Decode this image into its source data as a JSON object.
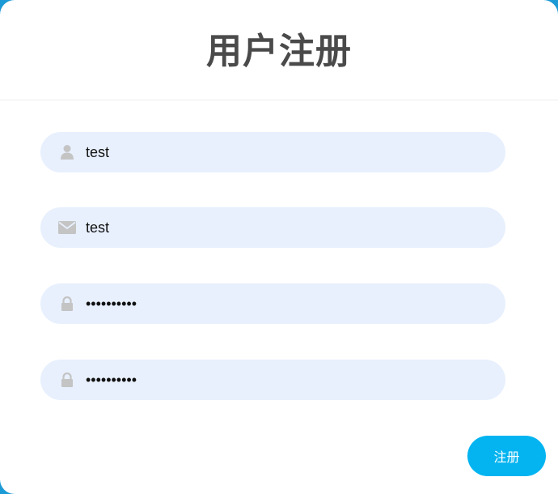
{
  "header": {
    "title": "用户注册"
  },
  "form": {
    "fields": [
      {
        "icon": "user-icon",
        "type": "text",
        "value": "test"
      },
      {
        "icon": "envelope-icon",
        "type": "text",
        "value": "test"
      },
      {
        "icon": "lock-icon",
        "type": "password",
        "value": "••••••••••"
      },
      {
        "icon": "lock-icon",
        "type": "password",
        "value": "••••••••••"
      }
    ],
    "submit_label": "注册"
  },
  "colors": {
    "field_bg": "#e8f0fe",
    "accent": "#04b4f0",
    "title": "#4a4a4a",
    "icon": "#c4c4c4"
  }
}
